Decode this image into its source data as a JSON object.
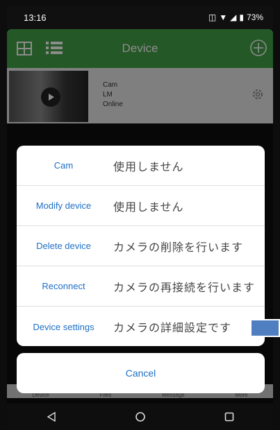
{
  "status_bar": {
    "time": "13:16",
    "battery": "73%"
  },
  "app_bar": {
    "title": "Device"
  },
  "device": {
    "name": "Cam",
    "id": "LM",
    "status": "Online"
  },
  "bottom_tabs": [
    "Device",
    "Files",
    "Message",
    "More"
  ],
  "sheet": {
    "items": [
      {
        "label": "Cam",
        "note": "使用しません"
      },
      {
        "label": "Modify device",
        "note": "使用しません"
      },
      {
        "label": "Delete device",
        "note": "カメラの削除を行います"
      },
      {
        "label": "Reconnect",
        "note": "カメラの再接続を行います"
      },
      {
        "label": "Device settings",
        "note": "カメラの詳細設定です"
      }
    ],
    "cancel": "Cancel"
  },
  "colors": {
    "accent_green": "#43a047",
    "link_blue": "#1e6fc6"
  }
}
